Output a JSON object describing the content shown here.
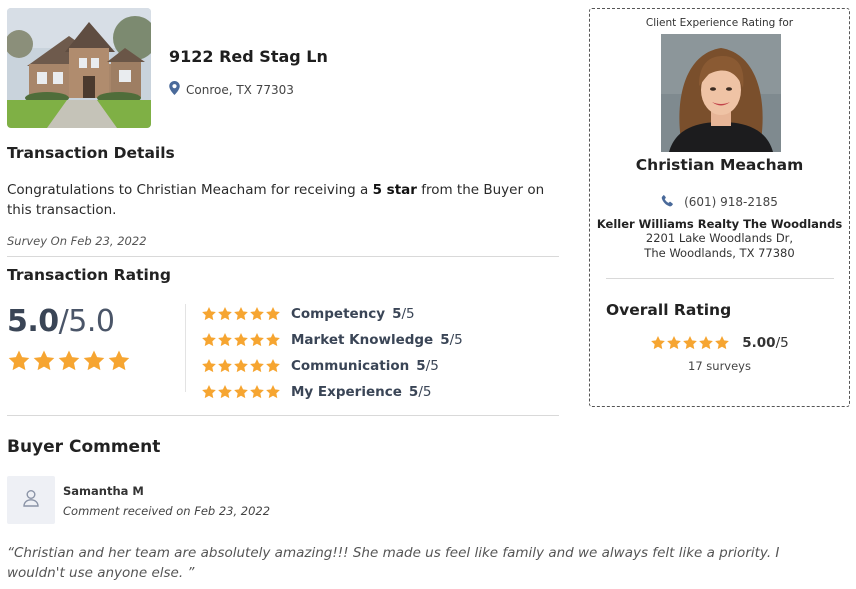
{
  "listing": {
    "photo_alt": "house photo",
    "address": "9122 Red Stag Ln",
    "city": "Conroe, TX 77303"
  },
  "transaction": {
    "heading": "Transaction Details",
    "congrats_prefix": "Congratulations to Christian Meacham for receiving a ",
    "congrats_bold": "5 star",
    "congrats_suffix": " from the Buyer on this transaction.",
    "survey_date": "Survey On Feb 23, 2022"
  },
  "rating": {
    "heading": "Transaction Rating",
    "score": "5.0",
    "out_of": "/5.0",
    "stars": 5,
    "categories": [
      {
        "label": "Competency",
        "score": "5",
        "out_of": "/5",
        "stars": 5
      },
      {
        "label": "Market Knowledge",
        "score": "5",
        "out_of": "/5",
        "stars": 5
      },
      {
        "label": "Communication",
        "score": "5",
        "out_of": "/5",
        "stars": 5
      },
      {
        "label": "My Experience",
        "score": "5",
        "out_of": "/5",
        "stars": 5
      }
    ]
  },
  "comment": {
    "heading": "Buyer Comment",
    "author": "Samantha M",
    "date": "Comment received on Feb 23, 2022",
    "text": "“Christian and her team are absolutely amazing!!! She made us feel like family and we always felt like a priority. I wouldn't use anyone else. ”"
  },
  "agent": {
    "caption": "Client Experience Rating for",
    "name": "Christian Meacham",
    "phone": "(601) 918-2185",
    "broker": "Keller Williams Realty The Woodlands",
    "address_line1": "2201 Lake Woodlands Dr,",
    "address_line2": "The Woodlands, TX 77380",
    "overall_heading": "Overall Rating",
    "overall_score": "5.00",
    "overall_out_of": "/5",
    "overall_stars": 5,
    "surveys": "17 surveys"
  },
  "colors": {
    "star": "#f6a531",
    "text_dark": "#222222",
    "rating_text": "#3a4556",
    "pin": "#4a6a9a"
  }
}
